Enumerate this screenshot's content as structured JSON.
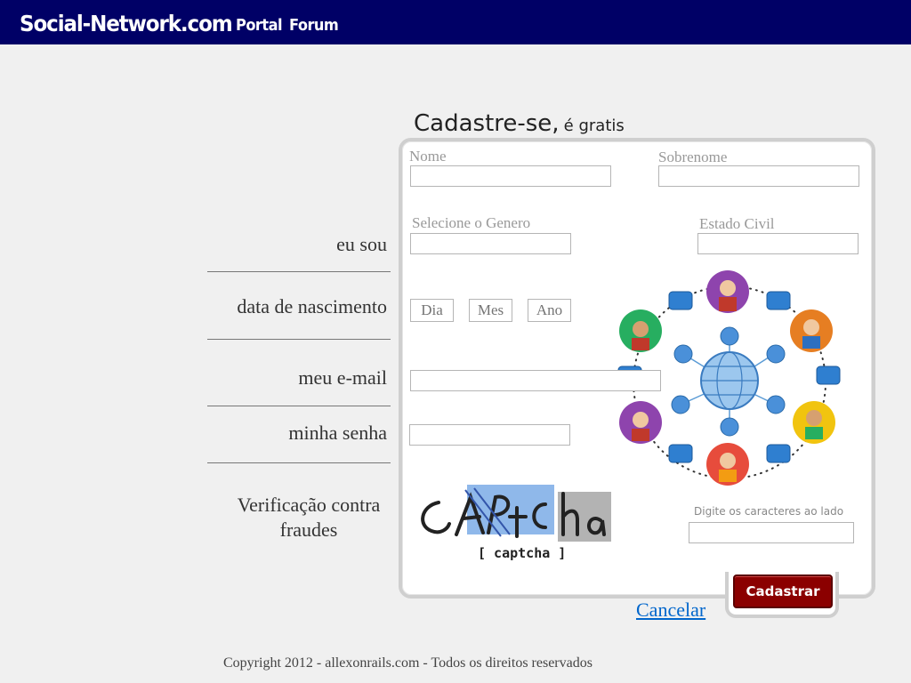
{
  "header": {
    "brand": "Social-Network.com",
    "nav": [
      {
        "label": "Portal"
      },
      {
        "label": "Forum"
      }
    ]
  },
  "form": {
    "heading": "Cadastre-se,",
    "subheading": "é gratis",
    "labels": {
      "nome": "Nome",
      "sobrenome": "Sobrenome",
      "genero": "Selecione o Genero",
      "estado_civil": "Estado Civil",
      "captcha_prompt": "Digite os caracteres ao lado"
    },
    "left_labels": {
      "eu_sou": "eu sou",
      "nascimento": "data de nascimento",
      "email": "meu e-mail",
      "senha": "minha senha",
      "verificacao": "Verificação contra fraudes"
    },
    "birth_placeholders": {
      "dia": "Dia",
      "mes": "Mes",
      "ano": "Ano"
    },
    "submit_label": "Cadastrar",
    "cancel_label": "Cancelar"
  },
  "footer": {
    "text": "Copyright 2012 - allexonrails.com - Todos os direitos reservados"
  },
  "colors": {
    "topbar": "#000066",
    "submit": "#8b0000",
    "link": "#0066cc"
  }
}
